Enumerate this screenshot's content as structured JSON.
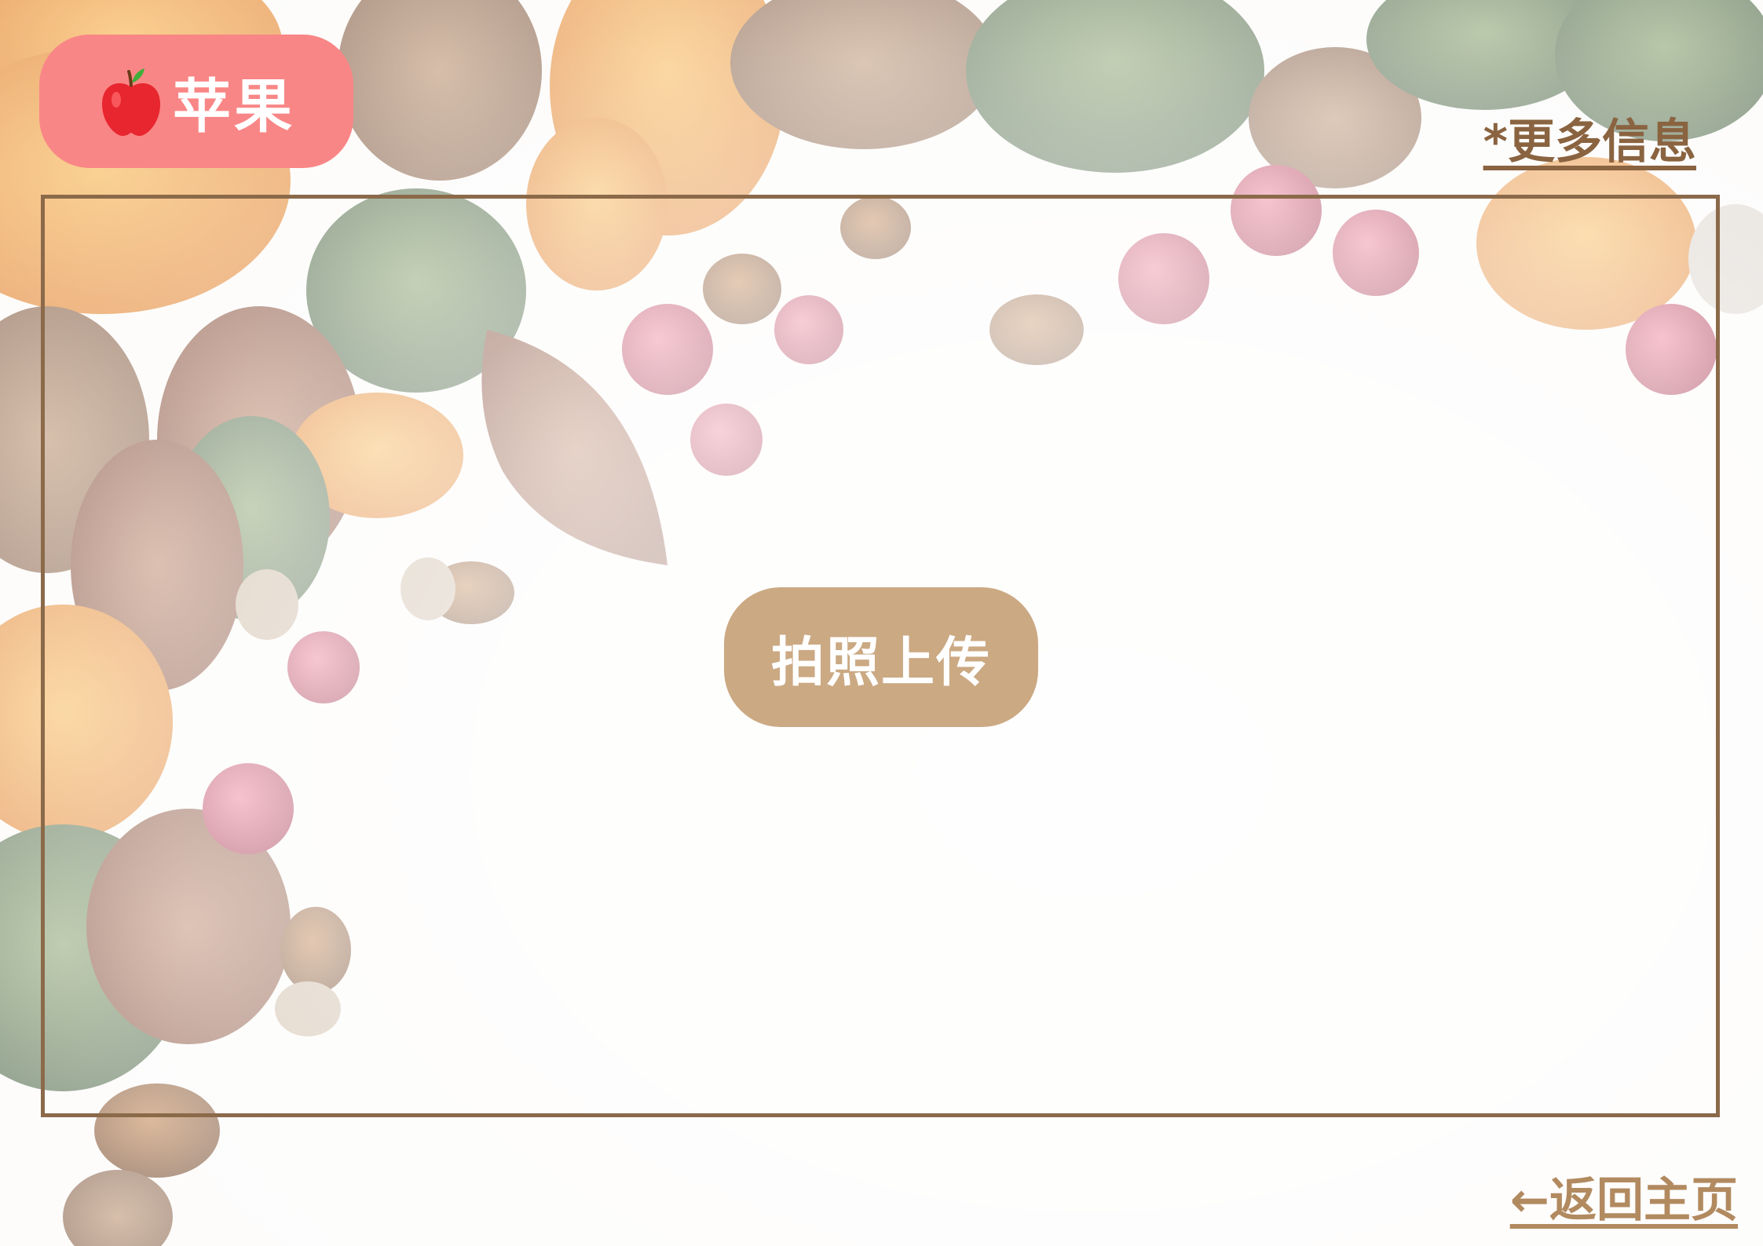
{
  "category": {
    "label": "苹果",
    "icon": "apple-icon",
    "badge_color": "#f98686"
  },
  "header": {
    "more_info_label": "*更多信息"
  },
  "main": {
    "upload_label": "拍照上传",
    "upload_color": "#cba983",
    "frame_color": "#8b6a4a"
  },
  "footer": {
    "back_label": "←返回主页"
  }
}
